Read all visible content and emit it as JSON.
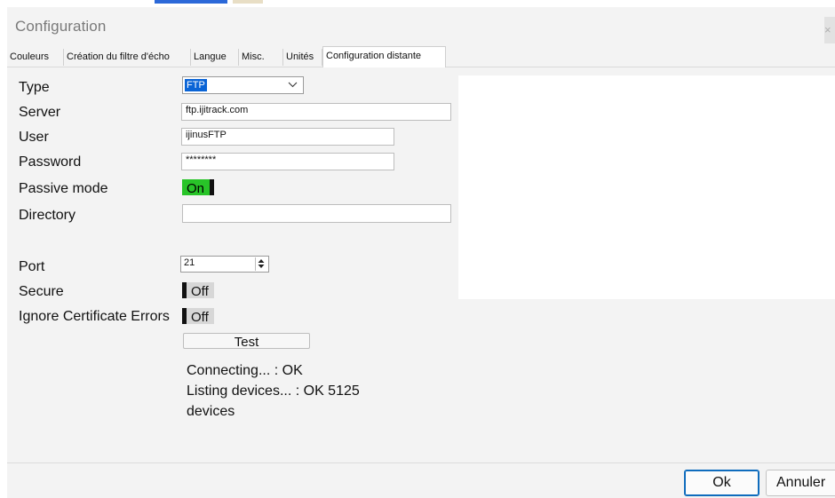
{
  "window": {
    "title": "Configuration",
    "close_glyph": "×"
  },
  "tabs": [
    {
      "label": "Couleurs"
    },
    {
      "label": "Création du filtre d'écho"
    },
    {
      "label": "Langue"
    },
    {
      "label": "Misc."
    },
    {
      "label": "Unités"
    },
    {
      "label": "Configuration distante",
      "active": true
    }
  ],
  "form": {
    "type_label": "Type",
    "type_value": "FTP",
    "server_label": "Server",
    "server_value": "ftp.ijitrack.com",
    "user_label": "User",
    "user_value": "ijinusFTP",
    "password_label": "Password",
    "password_value": "********",
    "passive_label": "Passive mode",
    "passive_value": "On",
    "directory_label": "Directory",
    "directory_value": "",
    "port_label": "Port",
    "port_value": "21",
    "secure_label": "Secure",
    "secure_value": "Off",
    "ignore_label": "Ignore Certificate Errors",
    "ignore_value": "Off",
    "test_label": "Test"
  },
  "status": {
    "line1": "Connecting... : OK",
    "line2": "Listing devices... : OK 5125",
    "line3": "devices"
  },
  "buttons": {
    "ok": "Ok",
    "cancel": "Annuler"
  },
  "colors": {
    "toggle_on": "#28c428",
    "toggle_off": "#d7d7d7",
    "selection": "#0a64d6",
    "accent": "#0f6cbd"
  }
}
